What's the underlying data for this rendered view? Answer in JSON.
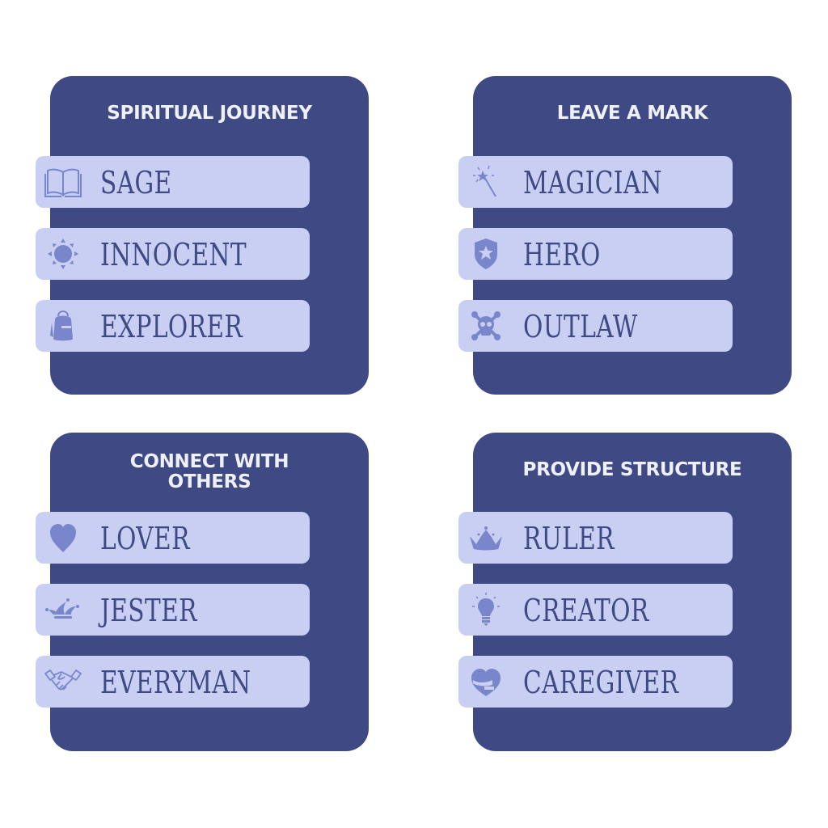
{
  "colors": {
    "panel": "#3f4a85",
    "item_bg": "#c8cff2",
    "item_text": "#3f4a85",
    "icon": "#7a86cc",
    "title_text": "#eef0fc",
    "background": "#ffffff"
  },
  "panels": [
    {
      "title": "SPIRITUAL JOURNEY",
      "items": [
        {
          "label": "SAGE",
          "icon": "open-book-icon"
        },
        {
          "label": "INNOCENT",
          "icon": "sun-icon"
        },
        {
          "label": "EXPLORER",
          "icon": "backpack-icon"
        }
      ]
    },
    {
      "title": "LEAVE A MARK",
      "items": [
        {
          "label": "MAGICIAN",
          "icon": "magic-wand-icon"
        },
        {
          "label": "HERO",
          "icon": "shield-star-icon"
        },
        {
          "label": "OUTLAW",
          "icon": "skull-crossbones-icon"
        }
      ]
    },
    {
      "title_line1": "CONNECT WITH",
      "title_line2": "OTHERS",
      "items": [
        {
          "label": "LOVER",
          "icon": "heart-icon"
        },
        {
          "label": "JESTER",
          "icon": "jester-hat-icon"
        },
        {
          "label": "EVERYMAN",
          "icon": "handshake-icon"
        }
      ]
    },
    {
      "title": "PROVIDE STRUCTURE",
      "items": [
        {
          "label": "RULER",
          "icon": "crown-icon"
        },
        {
          "label": "CREATOR",
          "icon": "lightbulb-icon"
        },
        {
          "label": "CAREGIVER",
          "icon": "hug-heart-icon"
        }
      ]
    }
  ]
}
